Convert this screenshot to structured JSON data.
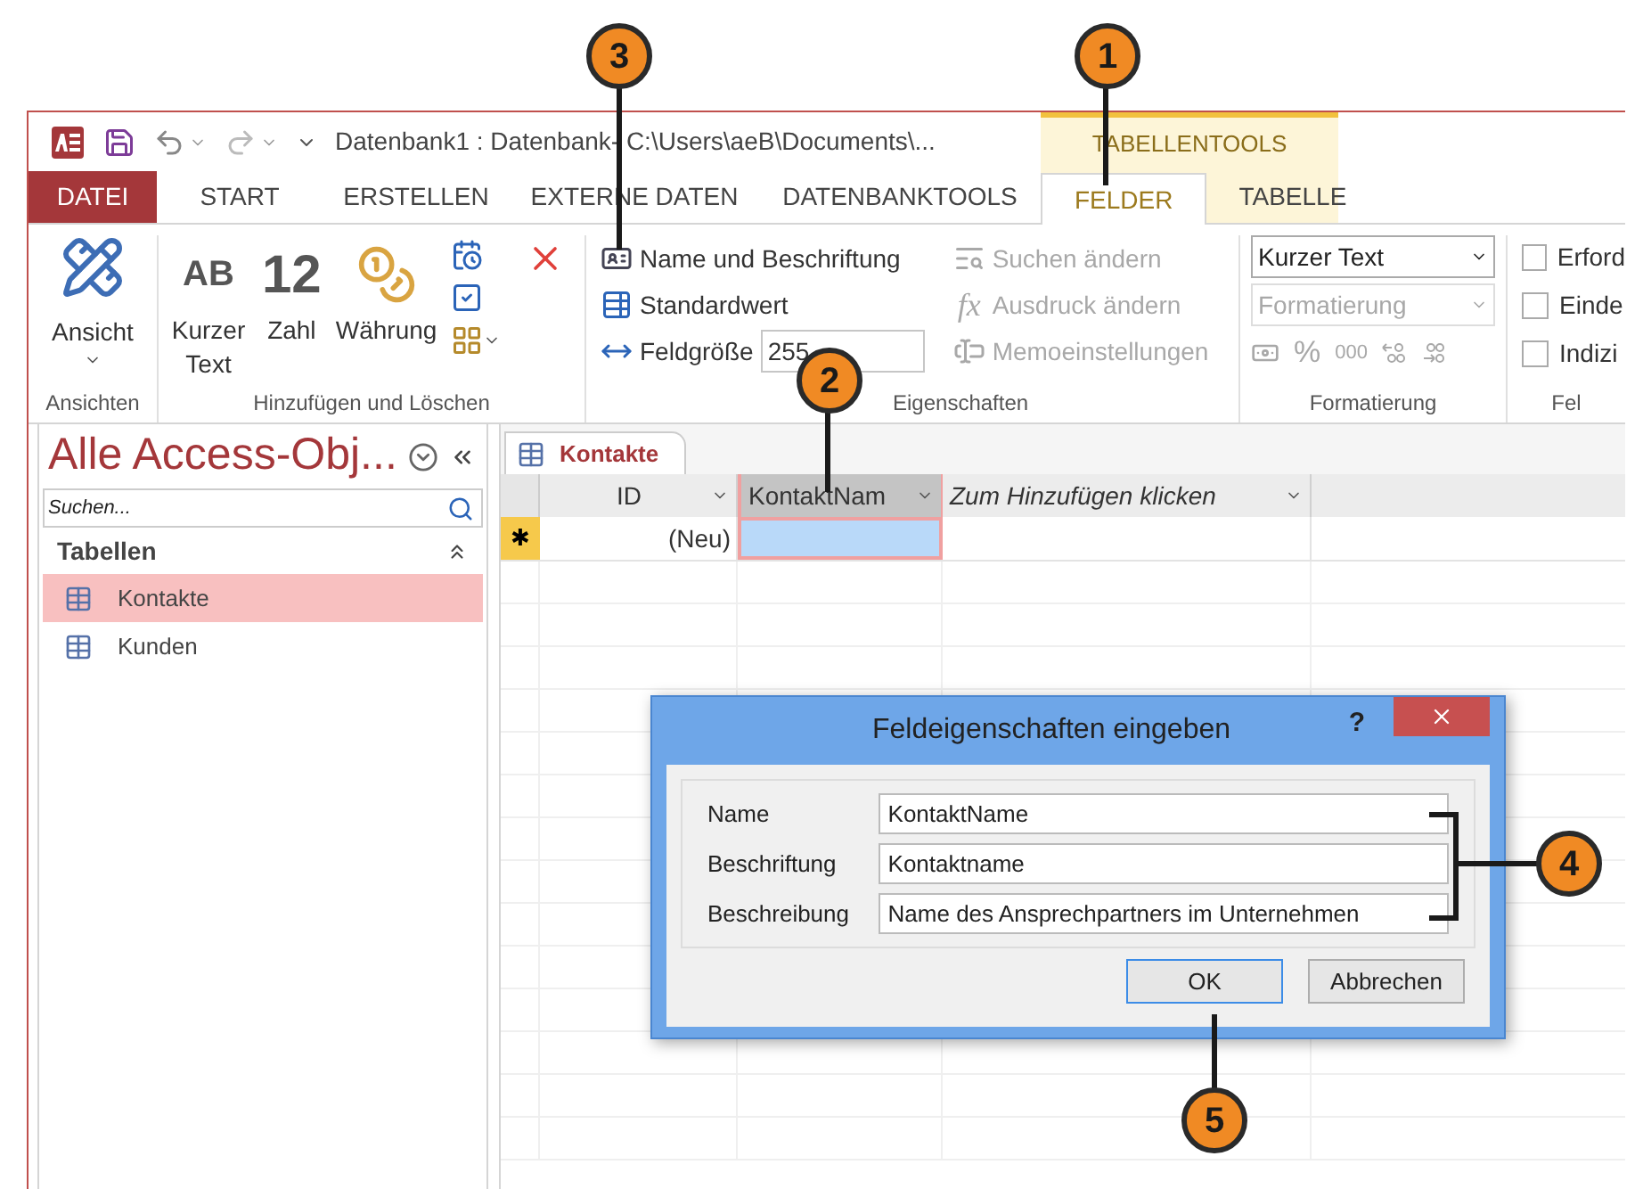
{
  "title_bar": {
    "title": "Datenbank1 : Datenbank- C:\\Users\\aeB\\Documents\\...",
    "context_header": "TABELLENTOOLS"
  },
  "ribbon_tabs": [
    {
      "label": "DATEI",
      "kind": "file",
      "selected": false
    },
    {
      "label": "START",
      "kind": "tab",
      "selected": false
    },
    {
      "label": "ERSTELLEN",
      "kind": "tab",
      "selected": false
    },
    {
      "label": "EXTERNE DATEN",
      "kind": "tab",
      "selected": false
    },
    {
      "label": "DATENBANKTOOLS",
      "kind": "tab",
      "selected": false
    },
    {
      "label": "FELDER",
      "kind": "context",
      "selected": true
    },
    {
      "label": "TABELLE",
      "kind": "context",
      "selected": false
    }
  ],
  "ribbon": {
    "views": {
      "button": "Ansicht",
      "group": "Ansichten"
    },
    "add_delete": {
      "buttons": [
        {
          "kind": "glyph",
          "glyph": "AB",
          "label": "Kurzer Text"
        },
        {
          "kind": "glyph",
          "glyph": "12",
          "label": "Zahl"
        },
        {
          "kind": "icon",
          "label": "Währung"
        }
      ],
      "group": "Hinzufügen und Löschen"
    },
    "properties": {
      "commands": [
        {
          "label": "Name und Beschriftung",
          "disabled": false
        },
        {
          "label": "Standardwert",
          "disabled": false
        },
        {
          "label": "Feldgröße",
          "disabled": false,
          "value": "255"
        }
      ],
      "more_commands": [
        {
          "label": "Suchen ändern",
          "disabled": true
        },
        {
          "label": "Ausdruck ändern",
          "disabled": true,
          "glyph": "fx"
        },
        {
          "label": "Memoeinstellungen",
          "disabled": true
        }
      ],
      "group": "Eigenschaften"
    },
    "formatting": {
      "data_type": "Kurzer Text",
      "format": {
        "placeholder": "Formatierung",
        "disabled": true
      },
      "symbols": {
        "items": [
          "%",
          "000"
        ],
        "disabled": true
      },
      "group": "Formatierung"
    },
    "validation": {
      "checkboxes": [
        {
          "label": "Erford",
          "checked": false
        },
        {
          "label": "Einde",
          "checked": false
        },
        {
          "label": "Indizi",
          "checked": false
        }
      ],
      "group": "Fel"
    }
  },
  "nav_pane": {
    "title": "Alle Access-Obj...",
    "search": {
      "placeholder": "Suchen..."
    },
    "section": "Tabellen",
    "expanded": true,
    "items": [
      {
        "label": "Kontakte",
        "selected": true
      },
      {
        "label": "Kunden",
        "selected": false
      }
    ]
  },
  "document_tab": {
    "label": "Kontakte",
    "selected": true
  },
  "datasheet": {
    "columns": [
      {
        "label": "ID",
        "kind": "field",
        "selected": false
      },
      {
        "label": "KontaktNam",
        "kind": "field",
        "selected": true
      },
      {
        "label": "Zum Hinzufügen klicken",
        "kind": "add",
        "selected": false
      }
    ],
    "new_row": {
      "marker": "✱",
      "id": "(Neu)"
    }
  },
  "dialog": {
    "title": "Feldeigenschaften eingeben",
    "help": "?",
    "fields": [
      {
        "label": "Name",
        "value": "KontaktName"
      },
      {
        "label": "Beschriftung",
        "value": "Kontaktname"
      },
      {
        "label": "Beschreibung",
        "value": "Name des Ansprechpartners im Unternehmen"
      }
    ],
    "buttons": [
      {
        "label": "OK",
        "focused": true
      },
      {
        "label": "Abbrechen",
        "focused": false
      }
    ]
  },
  "callouts": [
    "3",
    "1",
    "2",
    "4",
    "5"
  ]
}
